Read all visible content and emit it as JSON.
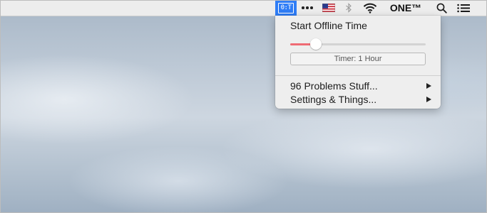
{
  "menubar": {
    "app_icon_text": "0:T",
    "network_name": "ONE™",
    "icons": [
      "app-icon",
      "more-icon",
      "us-flag-icon",
      "bluetooth-icon",
      "wifi-icon",
      "search-icon",
      "list-icon"
    ]
  },
  "dropdown": {
    "title": "Start Offline Time",
    "slider": {
      "value_fraction": 0.19,
      "accent_color": "#ef6b74"
    },
    "timer_label": "Timer: 1 Hour",
    "items": [
      {
        "label": "96 Problems Stuff...",
        "has_submenu": true
      },
      {
        "label": "Settings & Things...",
        "has_submenu": true
      }
    ]
  },
  "colors": {
    "menubar_selected": "#2f7df6",
    "slider_fill": "#ef6b74"
  }
}
